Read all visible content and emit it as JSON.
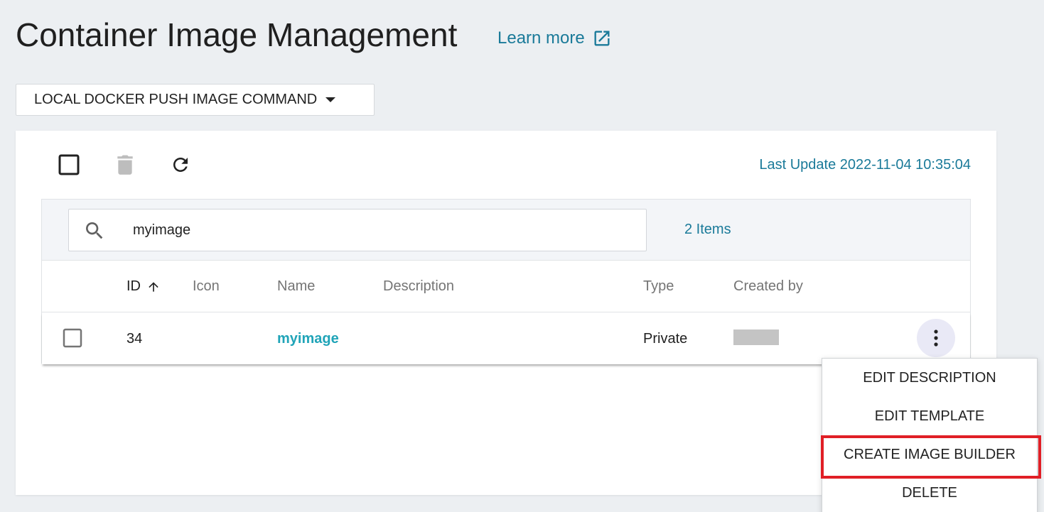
{
  "header": {
    "title": "Container Image Management",
    "learn_more": "Learn more"
  },
  "push_command": {
    "label": "LOCAL DOCKER PUSH IMAGE COMMAND"
  },
  "toolbar": {
    "last_update": "Last Update 2022-11-04 10:35:04"
  },
  "search": {
    "value": "myimage",
    "items_count": "2 Items"
  },
  "table": {
    "columns": [
      "ID",
      "Icon",
      "Name",
      "Description",
      "Type",
      "Created by"
    ],
    "rows": [
      {
        "id": "34",
        "name": "myimage",
        "description": "",
        "type": "Private"
      }
    ]
  },
  "context_menu": {
    "items": [
      "EDIT DESCRIPTION",
      "EDIT TEMPLATE",
      "CREATE IMAGE BUILDER",
      "DELETE"
    ],
    "highlighted": "CREATE IMAGE BUILDER"
  },
  "colors": {
    "accent": "#1a7a99",
    "link": "#20a4b8",
    "highlight_border": "#e01f26",
    "background": "#eceff2"
  }
}
